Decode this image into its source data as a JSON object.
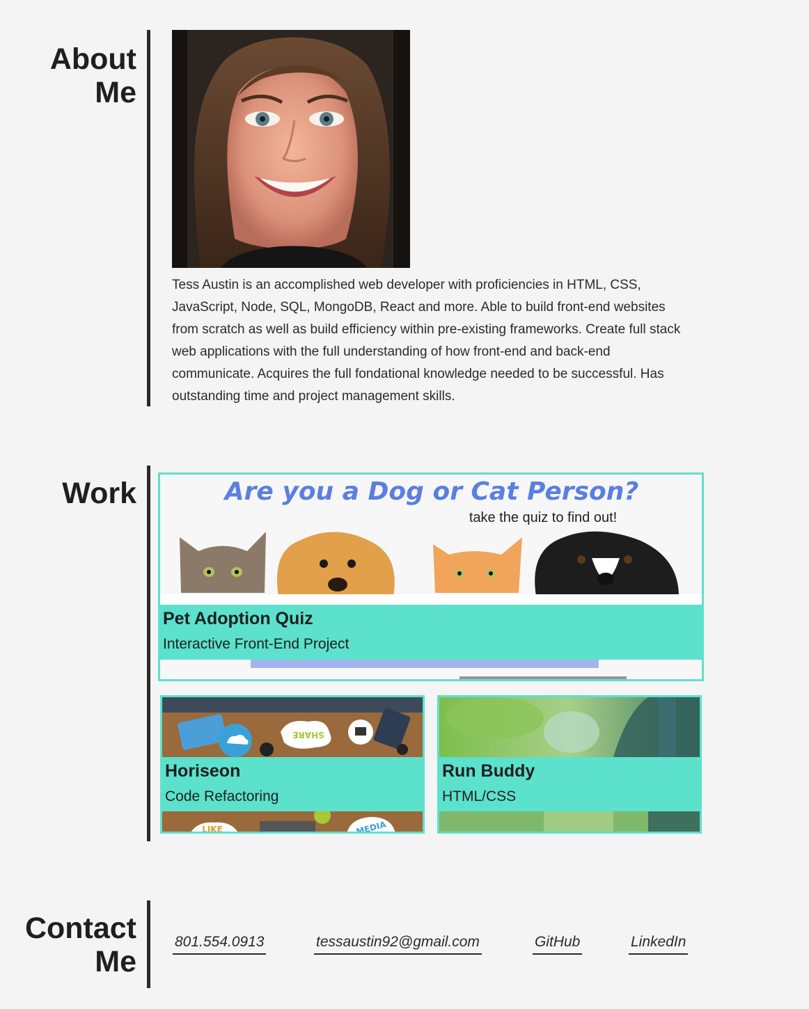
{
  "about": {
    "title_line1": "About",
    "title_line2": "Me",
    "bio": "Tess Austin is an accomplished web developer with proficiencies in HTML, CSS, JavaScript, Node, SQL, MongoDB, React and more. Able to build front-end websites from scratch as well as build efficiency within pre-existing frameworks. Create full stack web applications with the full understanding of how front-end and back-end communicate. Acquires the full fondational knowledge needed to be successful. Has outstanding time and project management skills."
  },
  "work": {
    "title": "Work",
    "projects": [
      {
        "title": "Pet Adoption Quiz",
        "subtitle": "Interactive Front-End Project",
        "image_headline": "Are you a Dog or Cat Person?",
        "image_tagline": "take the quiz to find out!"
      },
      {
        "title": "Horiseon",
        "subtitle": "Code Refactoring",
        "image_words": [
          "SHARE",
          "LIKE",
          "MEDIA"
        ]
      },
      {
        "title": "Run Buddy",
        "subtitle": "HTML/CSS"
      }
    ]
  },
  "contact": {
    "title_line1": "Contact",
    "title_line2": "Me",
    "links": [
      {
        "label": "801.554.0913"
      },
      {
        "label": "tessaustin92@gmail.com"
      },
      {
        "label": "GitHub"
      },
      {
        "label": "LinkedIn"
      }
    ]
  },
  "colors": {
    "background": "#f4f4f4",
    "accent": "#5ce1cd",
    "rule": "#2a2a2a",
    "text": "#222222"
  }
}
